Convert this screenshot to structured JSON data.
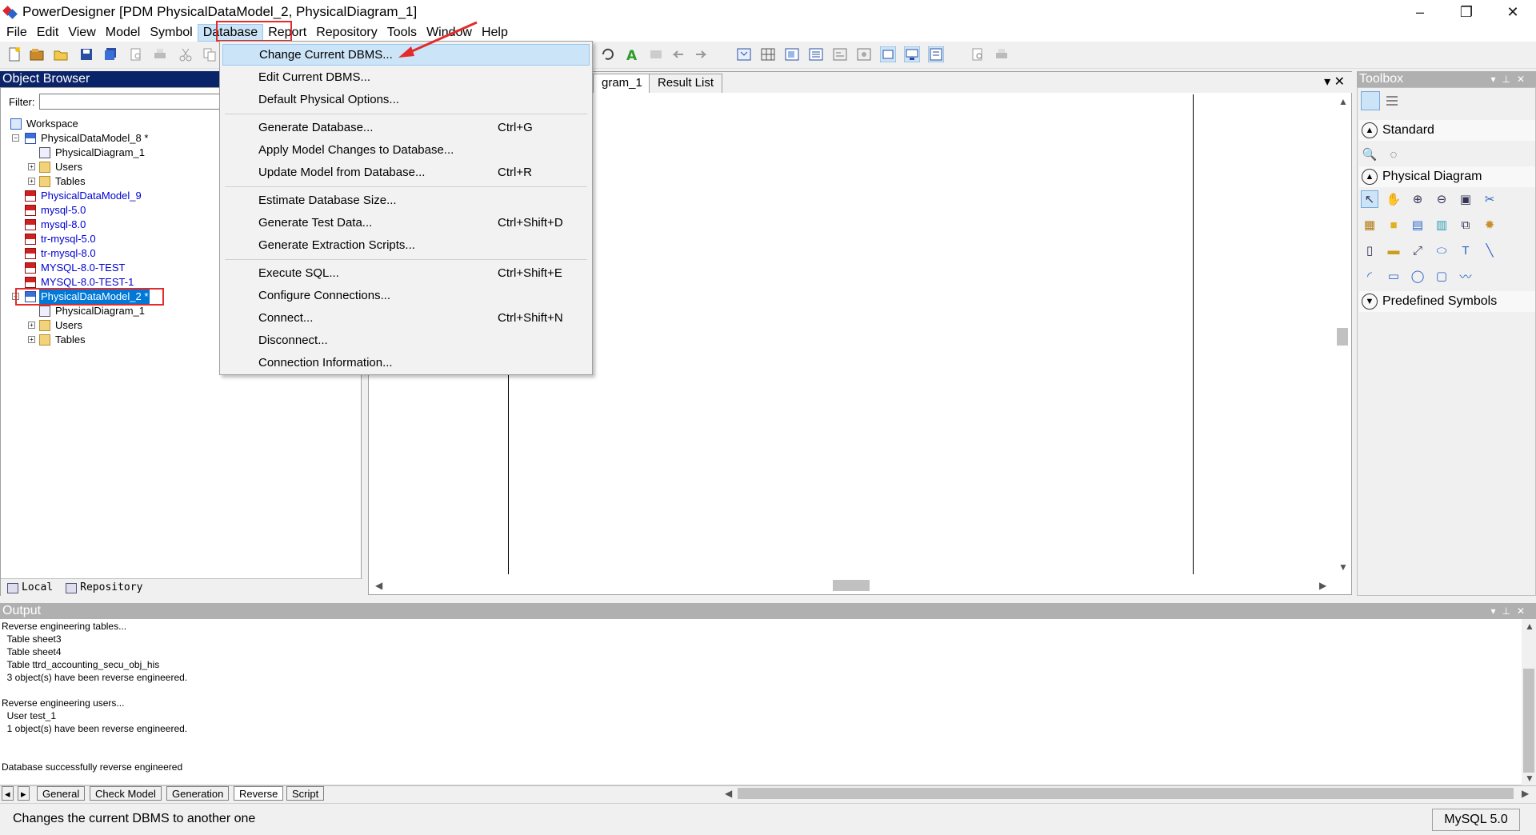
{
  "window": {
    "title": "PowerDesigner [PDM PhysicalDataModel_2, PhysicalDiagram_1]",
    "minimize": "–",
    "restore": "❐",
    "close": "✕"
  },
  "menu": [
    "File",
    "Edit",
    "View",
    "Model",
    "Symbol",
    "Database",
    "Report",
    "Repository",
    "Tools",
    "Window",
    "Help"
  ],
  "object_browser": {
    "title": "Object Browser",
    "filter_label": "Filter:",
    "filter_value": "",
    "tree": [
      {
        "label": "Workspace"
      },
      {
        "label": "PhysicalDataModel_8 *"
      },
      {
        "label": "PhysicalDiagram_1"
      },
      {
        "label": "Users"
      },
      {
        "label": "Tables"
      },
      {
        "label": "PhysicalDataModel_9"
      },
      {
        "label": "mysql-5.0"
      },
      {
        "label": "mysql-8.0"
      },
      {
        "label": "tr-mysql-5.0"
      },
      {
        "label": "tr-mysql-8.0"
      },
      {
        "label": "MYSQL-8.0-TEST"
      },
      {
        "label": "MYSQL-8.0-TEST-1"
      },
      {
        "label": "PhysicalDataModel_2 *"
      },
      {
        "label": "PhysicalDiagram_1"
      },
      {
        "label": "Users"
      },
      {
        "label": "Tables"
      }
    ],
    "tabs": [
      "Local",
      "Repository"
    ]
  },
  "database_menu": {
    "items": [
      {
        "label": "Change Current DBMS...",
        "shortcut": ""
      },
      {
        "label": "Edit Current DBMS...",
        "shortcut": ""
      },
      {
        "label": "Default Physical Options...",
        "shortcut": ""
      },
      {
        "label": "Generate Database...",
        "shortcut": "Ctrl+G"
      },
      {
        "label": "Apply Model Changes to Database...",
        "shortcut": ""
      },
      {
        "label": "Update Model from Database...",
        "shortcut": "Ctrl+R"
      },
      {
        "label": "Estimate Database Size...",
        "shortcut": ""
      },
      {
        "label": "Generate Test Data...",
        "shortcut": "Ctrl+Shift+D"
      },
      {
        "label": "Generate Extraction Scripts...",
        "shortcut": ""
      },
      {
        "label": "Execute SQL...",
        "shortcut": "Ctrl+Shift+E"
      },
      {
        "label": "Configure Connections...",
        "shortcut": ""
      },
      {
        "label": "Connect...",
        "shortcut": "Ctrl+Shift+N"
      },
      {
        "label": "Disconnect...",
        "shortcut": ""
      },
      {
        "label": "Connection Information...",
        "shortcut": ""
      }
    ]
  },
  "diagram": {
    "tabs": [
      "gram_1",
      "Result List"
    ],
    "controls": "▾  ✕"
  },
  "toolbox": {
    "title": "Toolbox",
    "sections": [
      "Standard",
      "Physical Diagram",
      "Predefined Symbols"
    ]
  },
  "output": {
    "title": "Output",
    "lines": [
      "Reverse engineering tables...",
      "  Table sheet3",
      "  Table sheet4",
      "  Table ttrd_accounting_secu_obj_his",
      "  3 object(s) have been reverse engineered.",
      "",
      "Reverse engineering users...",
      "  User test_1",
      "  1 object(s) have been reverse engineered.",
      "",
      "",
      "Database successfully reverse engineered"
    ],
    "tabs": [
      "General",
      "Check Model",
      "Generation",
      "Reverse",
      "Script"
    ]
  },
  "status": {
    "text": "Changes the current DBMS to another one",
    "dbms": "MySQL 5.0"
  },
  "colors": {
    "accent": "#0078d7",
    "highlight_red": "#e32b2b",
    "selection_blue": "#cce4f7"
  }
}
